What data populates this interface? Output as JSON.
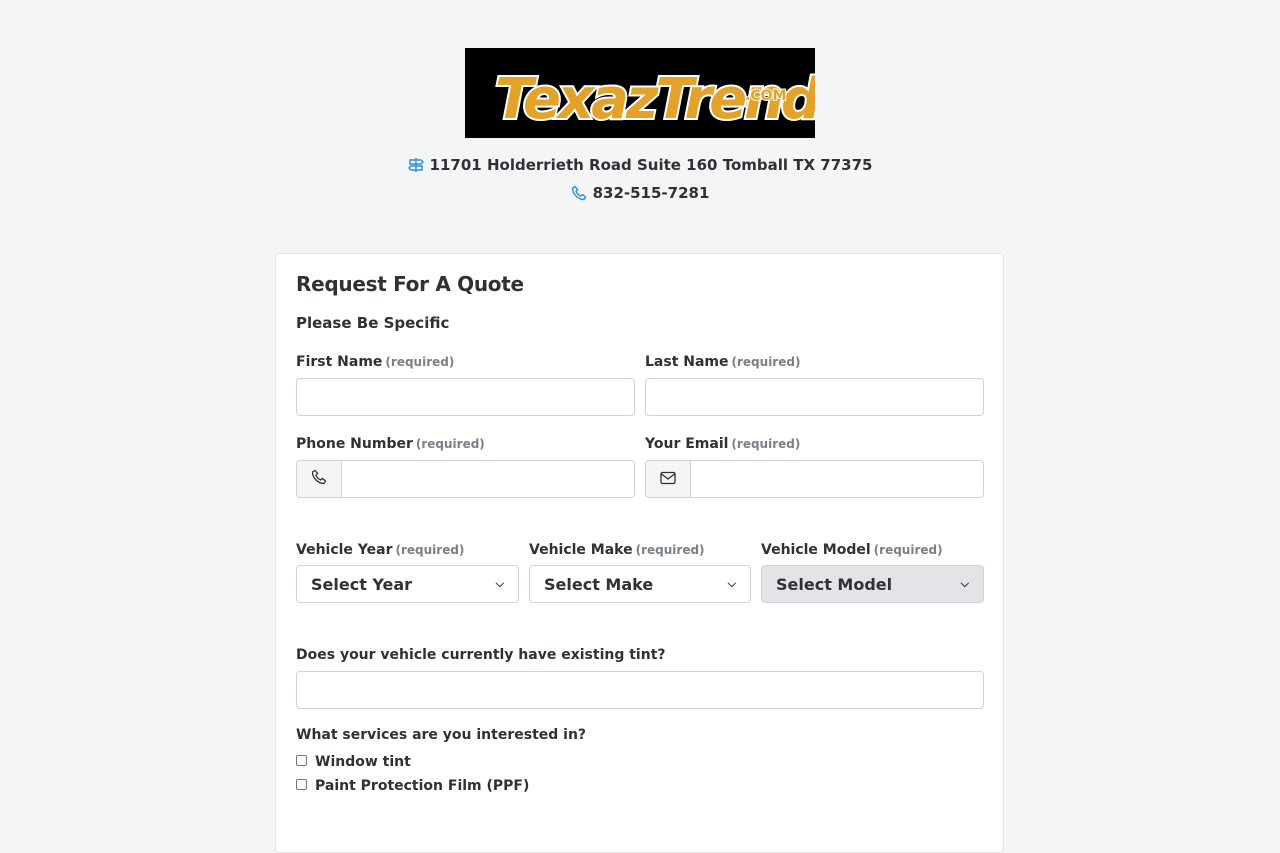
{
  "brand": {
    "logo_text": "TexazTrendz",
    "logo_suffix": ".COM",
    "address": "11701 Holderrieth Road Suite 160 Tomball TX 77375",
    "phone": "832-515-7281"
  },
  "form": {
    "title": "Request For A Quote",
    "subtitle": "Please Be Specific",
    "required_tag": "(required)",
    "first_name": {
      "label": "First Name",
      "value": ""
    },
    "last_name": {
      "label": "Last Name",
      "value": ""
    },
    "phone_number": {
      "label": "Phone Number",
      "value": ""
    },
    "email": {
      "label": "Your Email",
      "value": ""
    },
    "vehicle_year": {
      "label": "Vehicle Year",
      "selected": "Select Year"
    },
    "vehicle_make": {
      "label": "Vehicle Make",
      "selected": "Select Make"
    },
    "vehicle_model": {
      "label": "Vehicle Model",
      "selected": "Select Model"
    },
    "existing_tint": {
      "label": "Does your vehicle currently have existing tint?",
      "value": ""
    },
    "services": {
      "label": "What services are you interested in?",
      "options": [
        "Window tint",
        "Paint Protection Film (PPF)"
      ]
    }
  },
  "colors": {
    "background": "#f4f5f7",
    "icon_blue": "#2f8fd6",
    "logo_gold": "#e3a22a"
  }
}
